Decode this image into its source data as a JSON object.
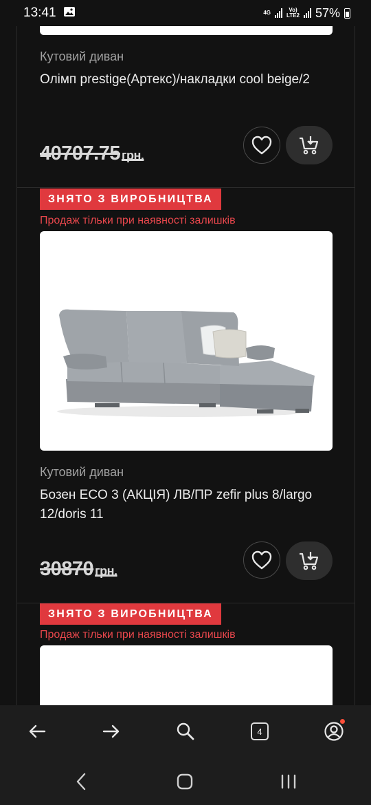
{
  "status_bar": {
    "time": "13:41",
    "network_top": "4G",
    "volte_line1": "Vo)",
    "volte_line2": "LTE2",
    "battery": "57%"
  },
  "products": [
    {
      "category": "Кутовий диван",
      "title": "Олімп prestige(Артекс)/накладки cool beige/2",
      "price": "40707.75",
      "currency": "грн."
    },
    {
      "badge": "ЗНЯТО З ВИРОБНИЦТВА",
      "notice": "Продаж тільки при наявності залишків",
      "category": "Кутовий диван",
      "title": "Бозен ECO 3 (АКЦІЯ) ЛВ/ПР zefir plus 8/largo 12/doris 11",
      "price": "30870",
      "currency": "грн."
    },
    {
      "badge": "ЗНЯТО З ВИРОБНИЦТВА",
      "notice": "Продаж тільки при наявності залишків"
    }
  ],
  "browser_bar": {
    "tab_count": "4"
  },
  "colors": {
    "background": "#121212",
    "badge": "#e0393e",
    "notice": "#e8474c",
    "button_bg": "#2e2e2e"
  },
  "icons": [
    "image-icon",
    "heart-icon",
    "add-to-cart-icon",
    "back-arrow-icon",
    "forward-arrow-icon",
    "search-icon",
    "tabs-icon",
    "account-icon",
    "nav-back-icon",
    "nav-home-icon",
    "nav-recents-icon"
  ]
}
